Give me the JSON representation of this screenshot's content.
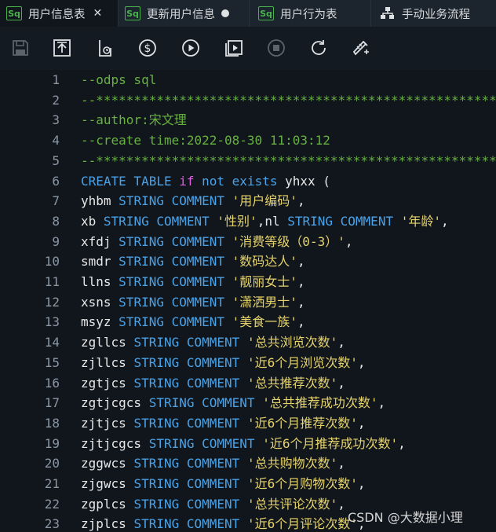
{
  "tabs": [
    {
      "icon": "Sq",
      "label": "用户信息表",
      "state": "close"
    },
    {
      "icon": "Sq",
      "label": "更新用户信息",
      "state": "modified"
    },
    {
      "icon": "Sq",
      "label": "用户行为表",
      "state": "none"
    },
    {
      "icon": "workflow-icon",
      "label": "手动业务流程",
      "state": "none"
    }
  ],
  "toolbar": {
    "icons": [
      "save-icon",
      "upload-icon",
      "clock-icon",
      "dollar-icon",
      "run-icon",
      "run-to-icon",
      "stop-icon",
      "refresh-icon",
      "format-icon"
    ]
  },
  "editor": {
    "lines": [
      {
        "n": "1",
        "segs": [
          {
            "c": "c",
            "t": "--odps sql"
          }
        ]
      },
      {
        "n": "2",
        "segs": [
          {
            "c": "c",
            "t": "--*************************************************************"
          }
        ]
      },
      {
        "n": "3",
        "segs": [
          {
            "c": "c",
            "t": "--author:宋文理"
          }
        ]
      },
      {
        "n": "4",
        "segs": [
          {
            "c": "c",
            "t": "--create time:2022-08-30 11:03:12"
          }
        ]
      },
      {
        "n": "5",
        "segs": [
          {
            "c": "c",
            "t": "--*************************************************************"
          }
        ]
      },
      {
        "n": "6",
        "segs": [
          {
            "c": "k",
            "t": "CREATE TABLE "
          },
          {
            "c": "p",
            "t": "if"
          },
          {
            "c": "k",
            "t": " not exists"
          },
          {
            "c": "t",
            "t": " yhxx ("
          }
        ]
      },
      {
        "n": "7",
        "segs": [
          {
            "c": "t",
            "t": "yhbm "
          },
          {
            "c": "k",
            "t": "STRING COMMENT "
          },
          {
            "c": "s",
            "t": "'用户编码'"
          },
          {
            "c": "t",
            "t": ","
          }
        ]
      },
      {
        "n": "8",
        "segs": [
          {
            "c": "t",
            "t": "xb "
          },
          {
            "c": "k",
            "t": "STRING COMMENT "
          },
          {
            "c": "s",
            "t": "'性别'"
          },
          {
            "c": "t",
            "t": ",nl "
          },
          {
            "c": "k",
            "t": "STRING COMMENT "
          },
          {
            "c": "s",
            "t": "'年龄'"
          },
          {
            "c": "t",
            "t": ","
          }
        ]
      },
      {
        "n": "9",
        "segs": [
          {
            "c": "t",
            "t": "xfdj "
          },
          {
            "c": "k",
            "t": "STRING COMMENT "
          },
          {
            "c": "s",
            "t": "'消费等级（0-3）'"
          },
          {
            "c": "t",
            "t": ","
          }
        ]
      },
      {
        "n": "10",
        "segs": [
          {
            "c": "t",
            "t": "smdr "
          },
          {
            "c": "k",
            "t": "STRING COMMENT "
          },
          {
            "c": "s",
            "t": "'数码达人'"
          },
          {
            "c": "t",
            "t": ","
          }
        ]
      },
      {
        "n": "11",
        "segs": [
          {
            "c": "t",
            "t": "llns "
          },
          {
            "c": "k",
            "t": "STRING COMMENT "
          },
          {
            "c": "s",
            "t": "'靓丽女士'"
          },
          {
            "c": "t",
            "t": ","
          }
        ]
      },
      {
        "n": "12",
        "segs": [
          {
            "c": "t",
            "t": "xsns "
          },
          {
            "c": "k",
            "t": "STRING COMMENT "
          },
          {
            "c": "s",
            "t": "'潇洒男士'"
          },
          {
            "c": "t",
            "t": ","
          }
        ]
      },
      {
        "n": "13",
        "segs": [
          {
            "c": "t",
            "t": "msyz "
          },
          {
            "c": "k",
            "t": "STRING COMMENT "
          },
          {
            "c": "s",
            "t": "'美食一族'"
          },
          {
            "c": "t",
            "t": ","
          }
        ]
      },
      {
        "n": "14",
        "segs": [
          {
            "c": "t",
            "t": "zgllcs "
          },
          {
            "c": "k",
            "t": "STRING COMMENT "
          },
          {
            "c": "s",
            "t": "'总共浏览次数'"
          },
          {
            "c": "t",
            "t": ","
          }
        ]
      },
      {
        "n": "15",
        "segs": [
          {
            "c": "t",
            "t": "zjllcs "
          },
          {
            "c": "k",
            "t": "STRING COMMENT "
          },
          {
            "c": "s",
            "t": "'近6个月浏览次数'"
          },
          {
            "c": "t",
            "t": ","
          }
        ]
      },
      {
        "n": "16",
        "segs": [
          {
            "c": "t",
            "t": "zgtjcs "
          },
          {
            "c": "k",
            "t": "STRING COMMENT "
          },
          {
            "c": "s",
            "t": "'总共推荐次数'"
          },
          {
            "c": "t",
            "t": ","
          }
        ]
      },
      {
        "n": "17",
        "segs": [
          {
            "c": "t",
            "t": "zgtjcgcs "
          },
          {
            "c": "k",
            "t": "STRING COMMENT "
          },
          {
            "c": "s",
            "t": "'总共推荐成功次数'"
          },
          {
            "c": "t",
            "t": ","
          }
        ]
      },
      {
        "n": "18",
        "segs": [
          {
            "c": "t",
            "t": "zjtjcs "
          },
          {
            "c": "k",
            "t": "STRING COMMENT "
          },
          {
            "c": "s",
            "t": "'近6个月推荐次数'"
          },
          {
            "c": "t",
            "t": ","
          }
        ]
      },
      {
        "n": "19",
        "segs": [
          {
            "c": "t",
            "t": "zjtjcgcs "
          },
          {
            "c": "k",
            "t": "STRING COMMENT "
          },
          {
            "c": "s",
            "t": "'近6个月推荐成功次数'"
          },
          {
            "c": "t",
            "t": ","
          }
        ]
      },
      {
        "n": "20",
        "segs": [
          {
            "c": "t",
            "t": "zggwcs "
          },
          {
            "c": "k",
            "t": "STRING COMMENT "
          },
          {
            "c": "s",
            "t": "'总共购物次数'"
          },
          {
            "c": "t",
            "t": ","
          }
        ]
      },
      {
        "n": "21",
        "segs": [
          {
            "c": "t",
            "t": "zjgwcs "
          },
          {
            "c": "k",
            "t": "STRING COMMENT "
          },
          {
            "c": "s",
            "t": "'近6个月购物次数'"
          },
          {
            "c": "t",
            "t": ","
          }
        ]
      },
      {
        "n": "22",
        "segs": [
          {
            "c": "t",
            "t": "zgplcs "
          },
          {
            "c": "k",
            "t": "STRING COMMENT "
          },
          {
            "c": "s",
            "t": "'总共评论次数'"
          },
          {
            "c": "t",
            "t": ","
          }
        ]
      },
      {
        "n": "23",
        "segs": [
          {
            "c": "t",
            "t": "zjplcs "
          },
          {
            "c": "k",
            "t": "STRING COMMENT "
          },
          {
            "c": "s",
            "t": "'近6个月评论次数'"
          },
          {
            "c": "t",
            "t": ","
          }
        ]
      }
    ]
  },
  "watermark": "CSDN @大数据小理"
}
